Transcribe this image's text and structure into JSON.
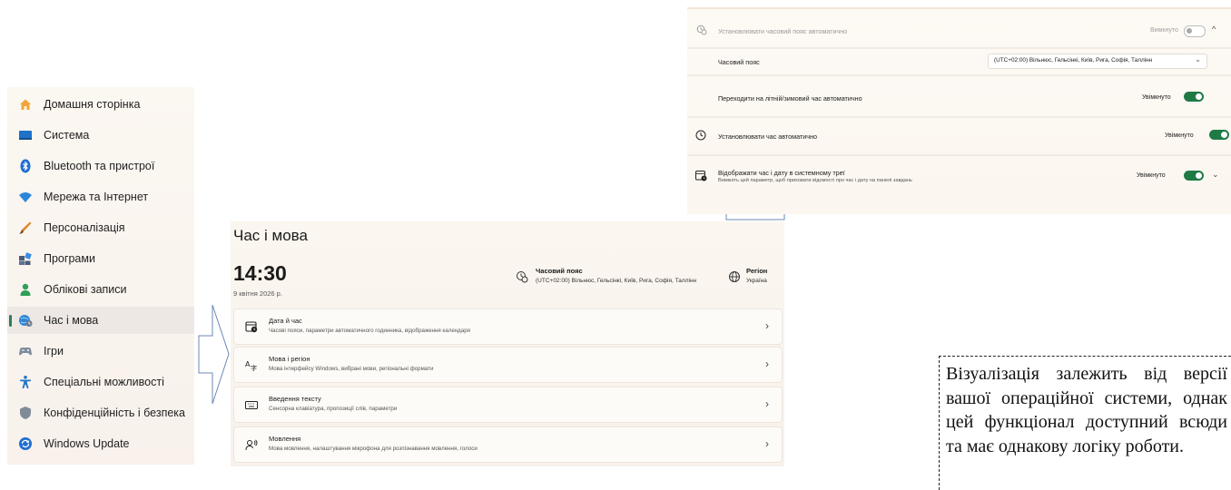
{
  "sidebar": {
    "items": [
      {
        "label": "Домашня сторінка",
        "icon": "home-icon",
        "selected": false
      },
      {
        "label": "Система",
        "icon": "monitor-icon",
        "selected": false
      },
      {
        "label": "Bluetooth та пристрої",
        "icon": "bluetooth-icon",
        "selected": false
      },
      {
        "label": "Мережа та Інтернет",
        "icon": "wifi-icon",
        "selected": false
      },
      {
        "label": "Персоналізація",
        "icon": "brush-icon",
        "selected": false
      },
      {
        "label": "Програми",
        "icon": "apps-icon",
        "selected": false
      },
      {
        "label": "Облікові записи",
        "icon": "account-icon",
        "selected": false
      },
      {
        "label": "Час і мова",
        "icon": "globe-clock-icon",
        "selected": true
      },
      {
        "label": "Ігри",
        "icon": "gamepad-icon",
        "selected": false
      },
      {
        "label": "Спеціальні можливості",
        "icon": "accessibility-icon",
        "selected": false
      },
      {
        "label": "Конфіденційність і безпека",
        "icon": "shield-icon",
        "selected": false
      },
      {
        "label": "Windows Update",
        "icon": "update-icon",
        "selected": false
      }
    ]
  },
  "main": {
    "title": "Час і мова",
    "time": "14:30",
    "date": "9 квітня 2026 р.",
    "timezone_summary": {
      "label": "Часовий пояс",
      "value": "(UTC+02:00) Вільнюс, Гельсінкі, Київ, Рига, Софія, Таллінн",
      "icon": "timezone-icon"
    },
    "region_summary": {
      "label": "Регіон",
      "value": "Україна",
      "icon": "globe-icon"
    },
    "cards": [
      {
        "title": "Дата й час",
        "subtitle": "Часові пояси, параметри автоматичного годинника, відображення календаря",
        "icon": "date-time-icon"
      },
      {
        "title": "Мова і регіон",
        "subtitle": "Мова інтерфейсу Windows, вибрані мови, регіональні формати",
        "icon": "language-icon"
      },
      {
        "title": "Введення тексту",
        "subtitle": "Сенсорна клавіатура, пропозиції слів, параметри",
        "icon": "keyboard-icon"
      },
      {
        "title": "Мовлення",
        "subtitle": "Мова мовлення, налаштування мікрофона для розпізнавання мовлення, голоси",
        "icon": "speech-icon"
      }
    ]
  },
  "datetime_settings": {
    "auto_timezone": {
      "label": "Установлювати часовий пояс автоматично",
      "state": "Вимкнуто",
      "on": false
    },
    "timezone": {
      "label": "Часовий пояс",
      "value": "(UTC+02:00) Вільнюс, Гельсінкі, Київ, Рига, Софія, Таллінн"
    },
    "dst": {
      "label": "Переходити на літній/зимовий час автоматично",
      "state": "Увімкнуто",
      "on": true
    },
    "auto_time": {
      "label": "Установлювати час автоматично",
      "state": "Увімкнуто",
      "on": true
    },
    "tray": {
      "label": "Відображати час і дату в системному треї",
      "subtitle": "Вимкніть цей параметр, щоб приховати відомості про час і дату на панелі завдань",
      "state": "Увімкнуто",
      "on": true
    }
  },
  "note": {
    "text": "Візуалізація залежить від версії вашої операційної системи, однак цей функціонал доступний всюди та має однакову логіку роботи."
  },
  "colors": {
    "accent": "#1f7a45",
    "panel_bg": "#fbf6ef",
    "selected_bg": "#ede8e4"
  }
}
